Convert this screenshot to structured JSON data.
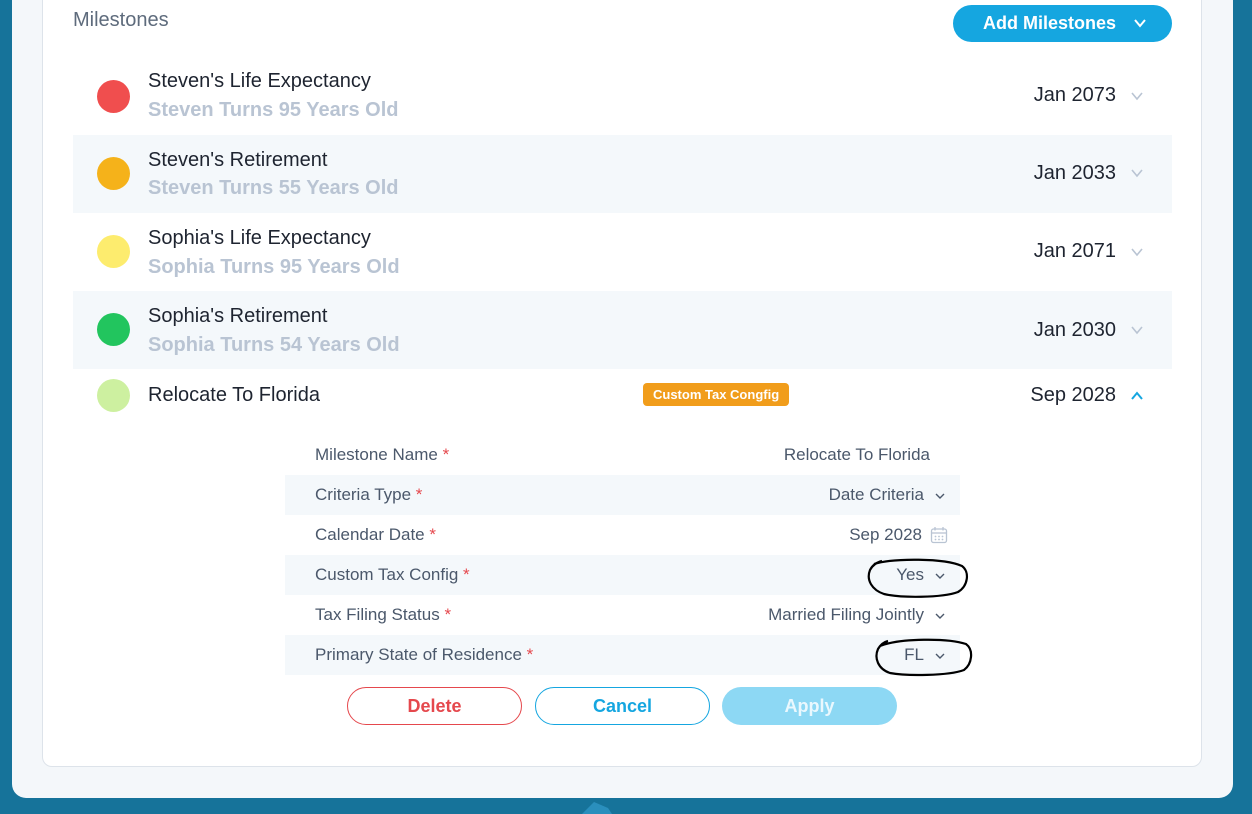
{
  "section": {
    "title": "Milestones",
    "add_button": "Add Milestones"
  },
  "milestones": [
    {
      "name": "Steven's Life Expectancy",
      "subtitle": "Steven Turns 95 Years Old",
      "date": "Jan 2073",
      "color": "#f04e4e"
    },
    {
      "name": "Steven's Retirement",
      "subtitle": "Steven Turns 55 Years Old",
      "date": "Jan 2033",
      "color": "#f5b21a"
    },
    {
      "name": "Sophia's Life Expectancy",
      "subtitle": "Sophia Turns 95 Years Old",
      "date": "Jan 2071",
      "color": "#fdec6e"
    },
    {
      "name": "Sophia's Retirement",
      "subtitle": "Sophia Turns 54 Years Old",
      "date": "Jan 2030",
      "color": "#22c55e"
    },
    {
      "name": "Relocate To Florida",
      "subtitle": "",
      "date": "Sep 2028",
      "color": "#cdf0a0",
      "badge": "Custom Tax Congfig"
    }
  ],
  "form": {
    "milestone_name": {
      "label": "Milestone Name",
      "value": "Relocate To Florida"
    },
    "criteria_type": {
      "label": "Criteria Type",
      "value": "Date Criteria"
    },
    "calendar_date": {
      "label": "Calendar Date",
      "value": "Sep 2028"
    },
    "custom_tax_config": {
      "label": "Custom Tax Config",
      "value": "Yes"
    },
    "tax_filing_status": {
      "label": "Tax Filing Status",
      "value": "Married Filing Jointly"
    },
    "primary_state": {
      "label": "Primary State of Residence",
      "value": "FL"
    },
    "required_mark": "*"
  },
  "actions": {
    "delete": "Delete",
    "cancel": "Cancel",
    "apply": "Apply"
  },
  "colors": {
    "accent": "#15a6e0",
    "danger": "#e5484d",
    "badge": "#f19d1b"
  }
}
